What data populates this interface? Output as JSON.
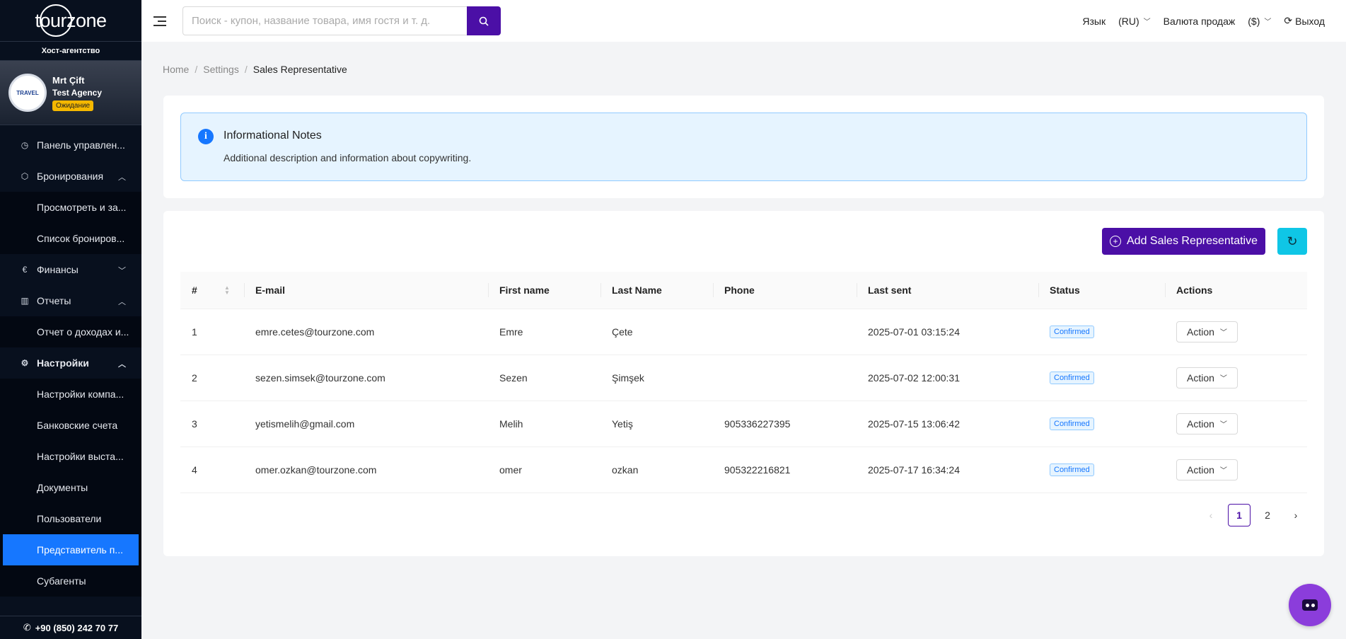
{
  "brand": {
    "logo_text": "tourzone"
  },
  "sidebar": {
    "agency_title": "Хост-агентство",
    "profile": {
      "name": "Mrt Çift",
      "agency": "Test Agency",
      "status": "Ожидание",
      "avatar_text": "TRAVEL"
    },
    "items": {
      "dashboard": "Панель управлен...",
      "bookings": "Бронирования",
      "bookings_view": "Просмотреть и за...",
      "bookings_list": "Список брониров...",
      "finance": "Финансы",
      "reports": "Отчеты",
      "reports_income": "Отчет о доходах и...",
      "settings": "Настройки",
      "settings_company": "Настройки компа...",
      "settings_bank": "Банковские счета",
      "settings_billing": "Настройки выста...",
      "settings_documents": "Документы",
      "settings_users": "Пользователи",
      "settings_sales_rep": "Представитель п...",
      "settings_subagents": "Субагенты"
    },
    "phone": "+90 (850) 242 70 77"
  },
  "topbar": {
    "search_placeholder": "Поиск - купон, название товара, имя гостя и т. д.",
    "language_label": "Язык",
    "language_value": "(RU)",
    "currency_label": "Валюта продаж",
    "currency_value": "($)",
    "logout": "Выход"
  },
  "breadcrumb": {
    "home": "Home",
    "settings": "Settings",
    "current": "Sales Representative"
  },
  "notes": {
    "title": "Informational Notes",
    "description": "Additional description and information about copywriting."
  },
  "toolbar": {
    "add_label": "Add Sales Representative"
  },
  "table": {
    "headers": {
      "index": "#",
      "email": "E-mail",
      "first_name": "First name",
      "last_name": "Last Name",
      "phone": "Phone",
      "last_sent": "Last sent",
      "status": "Status",
      "actions": "Actions"
    },
    "rows": [
      {
        "index": "1",
        "email": "emre.cetes@tourzone.com",
        "first_name": "Emre",
        "last_name": "Çete",
        "phone": "",
        "last_sent": "2025-07-01 03:15:24",
        "status": "Confirmed",
        "action": "Action"
      },
      {
        "index": "2",
        "email": "sezen.simsek@tourzone.com",
        "first_name": "Sezen",
        "last_name": "Şimşek",
        "phone": "",
        "last_sent": "2025-07-02 12:00:31",
        "status": "Confirmed",
        "action": "Action"
      },
      {
        "index": "3",
        "email": "yetismelih@gmail.com",
        "first_name": "Melih",
        "last_name": "Yetiş",
        "phone": "905336227395",
        "last_sent": "2025-07-15 13:06:42",
        "status": "Confirmed",
        "action": "Action"
      },
      {
        "index": "4",
        "email": "omer.ozkan@tourzone.com",
        "first_name": "omer",
        "last_name": "ozkan",
        "phone": "905322216821",
        "last_sent": "2025-07-17 16:34:24",
        "status": "Confirmed",
        "action": "Action"
      }
    ]
  },
  "pagination": {
    "page1": "1",
    "page2": "2"
  },
  "colors": {
    "primary": "#4b0fa6",
    "sidebar_bg": "#08101e",
    "active_item": "#1677ff",
    "refresh": "#0fc6e6",
    "info_bg": "#e6f4ff"
  }
}
